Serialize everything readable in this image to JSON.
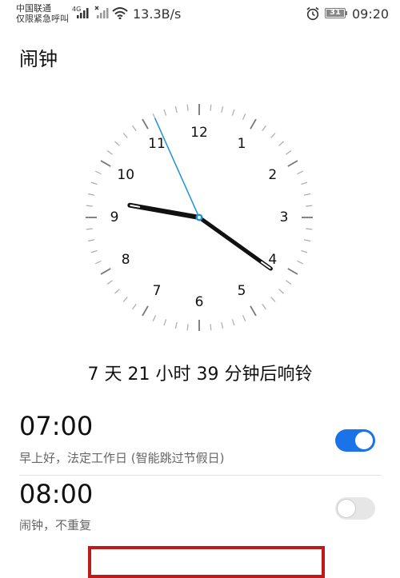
{
  "status_bar": {
    "carrier_line1": "中国联通",
    "carrier_line2": "仅限紧急呼叫",
    "net_type": "4G",
    "net_speed": "13.3B/s",
    "battery": "31",
    "time": "09:20"
  },
  "page": {
    "title": "闹钟"
  },
  "clock": {
    "numbers": [
      "12",
      "1",
      "2",
      "3",
      "4",
      "5",
      "6",
      "7",
      "8",
      "9",
      "10",
      "11"
    ],
    "time_shown": "09:20",
    "second_hand_seconds": 56
  },
  "countdown": "7 天 21 小时 39 分钟后响铃",
  "alarms": [
    {
      "time": "07:00",
      "desc": "早上好，法定工作日 (智能跳过节假日)",
      "enabled": true
    },
    {
      "time": "08:00",
      "desc": "闹钟，不重复",
      "enabled": false
    }
  ],
  "colors": {
    "accent": "#1a73e8",
    "second_hand": "#1e90d6",
    "highlight_box": "#c0191b"
  }
}
